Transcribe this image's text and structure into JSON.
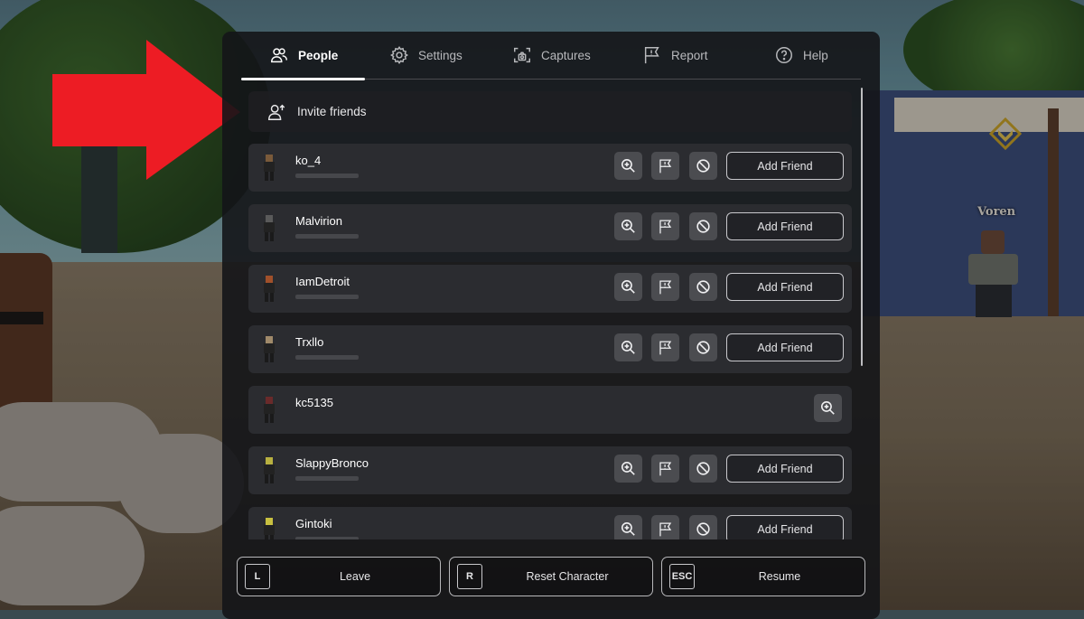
{
  "scene": {
    "npc_name": "Voren"
  },
  "menu": {
    "tabs": [
      {
        "label": "People",
        "icon": "people-icon",
        "active": true
      },
      {
        "label": "Settings",
        "icon": "gear-icon",
        "active": false
      },
      {
        "label": "Captures",
        "icon": "camera-icon",
        "active": false
      },
      {
        "label": "Report",
        "icon": "flag-icon",
        "active": false
      },
      {
        "label": "Help",
        "icon": "help-icon",
        "active": false
      }
    ],
    "invite_label": "Invite friends",
    "players": [
      {
        "name": "ko_4",
        "add_friend": "Add Friend",
        "actions": [
          "inspect",
          "report",
          "block",
          "add_friend"
        ]
      },
      {
        "name": "Malvirion",
        "add_friend": "Add Friend",
        "actions": [
          "inspect",
          "report",
          "block",
          "add_friend"
        ]
      },
      {
        "name": "IamDetroit",
        "add_friend": "Add Friend",
        "actions": [
          "inspect",
          "report",
          "block",
          "add_friend"
        ]
      },
      {
        "name": "Trxllo",
        "add_friend": "Add Friend",
        "actions": [
          "inspect",
          "report",
          "block",
          "add_friend"
        ]
      },
      {
        "name": "kc5135",
        "actions": [
          "inspect"
        ]
      },
      {
        "name": "SlappyBronco",
        "add_friend": "Add Friend",
        "actions": [
          "inspect",
          "report",
          "block",
          "add_friend"
        ]
      },
      {
        "name": "Gintoki",
        "add_friend": "Add Friend",
        "actions": [
          "inspect",
          "report",
          "block",
          "add_friend"
        ]
      }
    ],
    "bottom_buttons": [
      {
        "key": "L",
        "label": "Leave"
      },
      {
        "key": "R",
        "label": "Reset Character"
      },
      {
        "key": "ESC",
        "label": "Resume"
      }
    ]
  },
  "annotation": {
    "arrow_color": "#ed1c24",
    "points_to": "Invite friends"
  }
}
